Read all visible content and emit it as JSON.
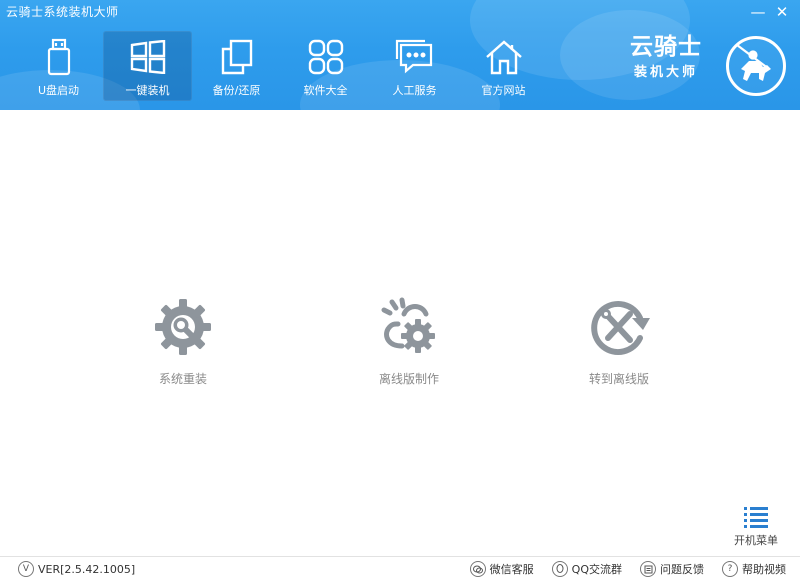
{
  "app": {
    "title": "云骑士系统装机大师"
  },
  "window_controls": {
    "minimize": "—",
    "close": "✕"
  },
  "nav": {
    "items": [
      {
        "label": "U盘启动",
        "icon": "usb-drive-icon"
      },
      {
        "label": "一键装机",
        "icon": "windows-icon",
        "active": true
      },
      {
        "label": "备份/还原",
        "icon": "backup-icon"
      },
      {
        "label": "软件大全",
        "icon": "apps-grid-icon"
      },
      {
        "label": "人工服务",
        "icon": "chat-icon"
      },
      {
        "label": "官方网站",
        "icon": "home-icon"
      }
    ]
  },
  "brand": {
    "name": "云骑士",
    "sub": "装机大师"
  },
  "features": [
    {
      "label": "系统重装",
      "icon": "gear-wrench-icon"
    },
    {
      "label": "离线版制作",
      "icon": "offline-gear-icon"
    },
    {
      "label": "转到离线版",
      "icon": "switch-tools-icon"
    }
  ],
  "boot_menu": {
    "label": "开机菜单"
  },
  "footer": {
    "version_icon": "V",
    "version": "VER[2.5.42.1005]",
    "links": [
      {
        "label": "微信客服",
        "icon": "wechat-icon"
      },
      {
        "label": "QQ交流群",
        "icon": "qq-icon"
      },
      {
        "label": "问题反馈",
        "icon": "feedback-icon"
      },
      {
        "label": "帮助视频",
        "icon": "help-icon"
      }
    ]
  },
  "colors": {
    "header": "#2e9cec",
    "feature_icon": "#8e959c",
    "text_gray": "#8a8a8a"
  }
}
